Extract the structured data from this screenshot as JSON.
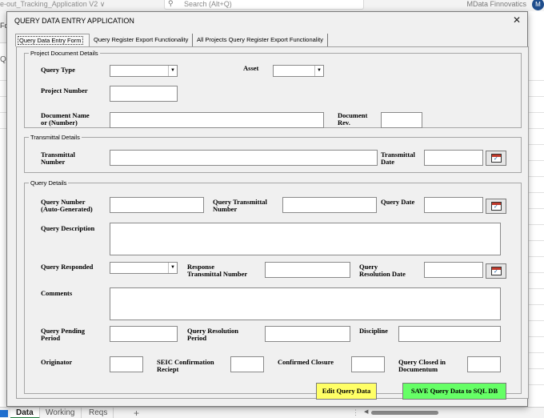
{
  "excel": {
    "file_title": "e-out_Tracking_Application V2 ∨",
    "search_placeholder": "Search (Alt+Q)",
    "user_name": "MData Finnovatics",
    "avatar_initial": "M",
    "ribbon_fragment": "For",
    "formula_fragment": "Q",
    "sheet_tabs": [
      "Data",
      "Working",
      "Reqs"
    ],
    "add_sheet": "+"
  },
  "dialog": {
    "title": "QUERY DATA ENTRY APPLICATION",
    "close": "✕",
    "tabs": [
      "Query Data Entry Form",
      "Query Register Export Functionality",
      "All Projects Query Register Export Functionality"
    ],
    "project_group": {
      "legend": "Project Document Details",
      "query_type": "Query Type",
      "asset": "Asset",
      "project_number": "Project Number",
      "document_name": [
        "Document Name",
        "or (Number)"
      ],
      "document_rev": [
        "Document",
        "Rev."
      ]
    },
    "transmittal_group": {
      "legend": "Transmittal Details",
      "transmittal_number": [
        "Transmittal",
        "Number"
      ],
      "transmittal_date": [
        "Transmittal",
        "Date"
      ]
    },
    "query_group": {
      "legend": "Query Details",
      "query_number": [
        "Query Number",
        "(Auto-Generated)"
      ],
      "query_transmittal_number": [
        "Query Transmittal",
        "Number"
      ],
      "query_date": "Query Date",
      "query_description": "Query Description",
      "query_responded": "Query Responded",
      "response_transmittal_number": [
        "Response",
        "Transmittal Number"
      ],
      "query_resolution_date": [
        "Query",
        "Resolution Date"
      ],
      "comments": "Comments",
      "query_pending_period": [
        "Query Pending",
        "Period"
      ],
      "query_resolution_period": [
        "Query Resolution",
        "Period"
      ],
      "discipline": "Discipline",
      "originator": "Originator",
      "seic_confirmation": [
        "SEIC Confirmation",
        "Reciept"
      ],
      "confirmed_closure": "Confirmed Closure",
      "query_closed_in": [
        "Query Closed in",
        "Documentum"
      ]
    },
    "buttons": {
      "edit": "Edit Query Data",
      "save": "SAVE Query Data to SQL DB"
    },
    "colors": {
      "edit_button": "#ffff66",
      "save_button": "#66ff66",
      "calendar_accent": "#c0392b"
    }
  }
}
